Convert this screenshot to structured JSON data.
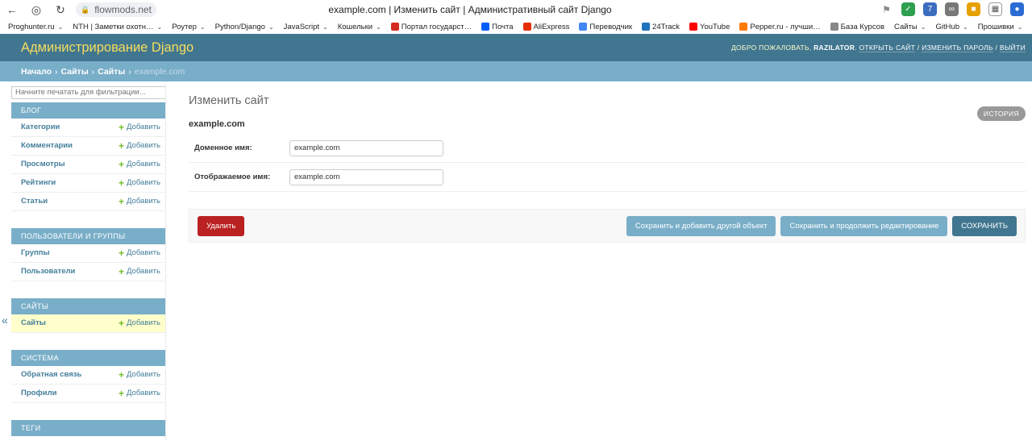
{
  "browser": {
    "url": "flowmods.net",
    "tab_title": "example.com | Изменить сайт | Административный сайт Django",
    "bookmarks": [
      {
        "label": "Proghunter.ru",
        "color": "",
        "caret": true
      },
      {
        "label": "NTH | Заметки охотн…",
        "color": "",
        "caret": true
      },
      {
        "label": "Роутер",
        "color": "",
        "caret": true
      },
      {
        "label": "Python/Django",
        "color": "",
        "caret": true
      },
      {
        "label": "JavaScript",
        "color": "",
        "caret": true
      },
      {
        "label": "Кошельки",
        "color": "",
        "caret": true
      },
      {
        "label": "Портал государст…",
        "color": "#d52b1e",
        "caret": false
      },
      {
        "label": "Почта",
        "color": "#005ff9",
        "caret": false
      },
      {
        "label": "AliExpress",
        "color": "#e62e04",
        "caret": false
      },
      {
        "label": "Переводчик",
        "color": "#4285f4",
        "caret": false
      },
      {
        "label": "24Track",
        "color": "#1e73be",
        "caret": false
      },
      {
        "label": "YouTube",
        "color": "#ff0000",
        "caret": false
      },
      {
        "label": "Pepper.ru - лучши…",
        "color": "#ff7a00",
        "caret": false
      },
      {
        "label": "База Курсов",
        "color": "#888888",
        "caret": false
      },
      {
        "label": "Сайты",
        "color": "",
        "caret": true
      },
      {
        "label": "GitHub",
        "color": "",
        "caret": true
      },
      {
        "label": "Прошивки",
        "color": "",
        "caret": true
      }
    ]
  },
  "header": {
    "branding": "Администрирование Django",
    "welcome": "Добро пожаловать,",
    "username": "RAZILATOR",
    "view_site": "Открыть сайт",
    "change_password": "Изменить пароль",
    "logout": "Выйти"
  },
  "breadcrumbs": {
    "home": "Начало",
    "app": "Сайты",
    "model": "Сайты",
    "current": "example.com"
  },
  "sidebar": {
    "filter_placeholder": "Начните печатать для фильтрации...",
    "add_label": "Добавить",
    "modules": [
      {
        "title": "Блог",
        "models": [
          {
            "name": "Категории",
            "current": false
          },
          {
            "name": "Комментарии",
            "current": false
          },
          {
            "name": "Просмотры",
            "current": false
          },
          {
            "name": "Рейтинги",
            "current": false
          },
          {
            "name": "Статьи",
            "current": false
          }
        ]
      },
      {
        "title": "Пользователи и группы",
        "models": [
          {
            "name": "Группы",
            "current": false
          },
          {
            "name": "Пользователи",
            "current": false
          }
        ]
      },
      {
        "title": "Сайты",
        "models": [
          {
            "name": "Сайты",
            "current": true
          }
        ]
      },
      {
        "title": "Система",
        "models": [
          {
            "name": "Обратная связь",
            "current": false
          },
          {
            "name": "Профили",
            "current": false
          }
        ]
      },
      {
        "title": "Теги",
        "models": []
      }
    ]
  },
  "content": {
    "title": "Изменить сайт",
    "history": "История",
    "object_name": "example.com",
    "fields": [
      {
        "label": "Доменное имя:",
        "value": "example.com",
        "name": "domain"
      },
      {
        "label": "Отображаемое имя:",
        "value": "example.com",
        "name": "display"
      }
    ],
    "delete": "Удалить",
    "save_add": "Сохранить и добавить другой объект",
    "save_continue": "Сохранить и продолжить редактирование",
    "save": "Сохранить"
  },
  "colors": {
    "header_bg": "#417690",
    "breadcrumbs_bg": "#79aec8",
    "branding": "#f5dd5d",
    "delete": "#ba2121",
    "add_plus": "#70bf2b",
    "current_row": "#ffffcc"
  }
}
